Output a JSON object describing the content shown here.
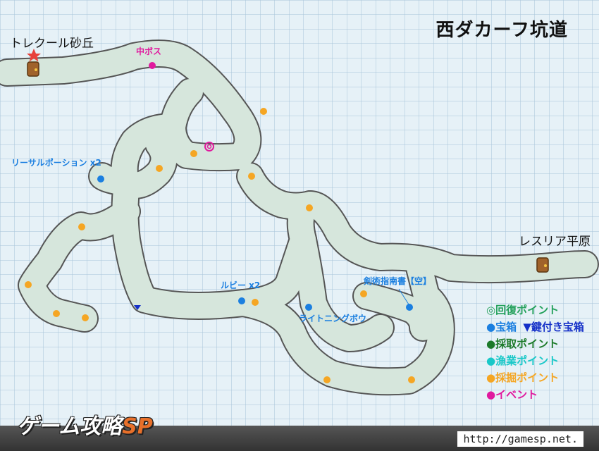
{
  "map": {
    "title": "西ダカーフ坑道",
    "colors": {
      "background": "#e6f1f7",
      "grid": "#a7c4d9",
      "cave_fill": "#d6e6dc",
      "cave_border": "#555555",
      "recovery": "#22a05a",
      "treasure": "#1b7fe0",
      "locked_treasure": "#1530c8",
      "gather": "#1c7a2a",
      "fishing": "#19c8c8",
      "mining": "#f5a623",
      "event": "#e0199e"
    }
  },
  "locations": {
    "west_exit": "トレクール砂丘",
    "east_exit": "レスリア平原"
  },
  "labels": {
    "mid_boss": "中ボス",
    "treasure_1": "リーサルポーション x2",
    "treasure_2": "ルビー x2",
    "treasure_3": "剣術指南書【空】",
    "treasure_4": "ライトニングボウ"
  },
  "legend": {
    "recovery": "◎回復ポイント",
    "treasure": "●宝箱",
    "locked_treasure": "▼鍵付き宝箱",
    "gather": "●採取ポイント",
    "fishing": "●漁業ポイント",
    "mining": "●採掘ポイント",
    "event": "●イベント"
  },
  "footer": {
    "brand_main": "ゲーム攻略",
    "brand_sp": "SP",
    "url": "http://gamesp.net."
  }
}
